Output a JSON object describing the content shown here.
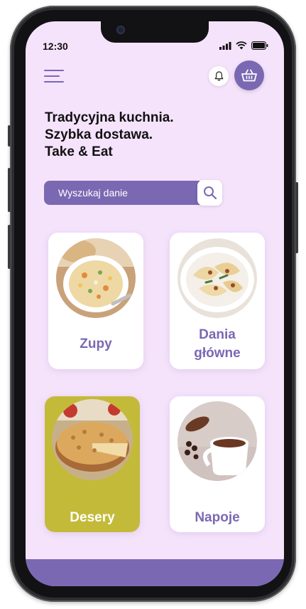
{
  "status_bar": {
    "time": "12:30"
  },
  "header": {
    "menu_icon": "hamburger-icon",
    "bell_icon": "bell-icon",
    "cart_icon": "basket-icon"
  },
  "headline": {
    "line1": "Tradycyjna kuchnia.",
    "line2": "Szybka dostawa.",
    "line3": "Take & Eat"
  },
  "search": {
    "placeholder": "Wyszukaj danie",
    "icon": "search-icon"
  },
  "categories": [
    {
      "label": "Zupy"
    },
    {
      "label_line1": "Dania",
      "label_line2": "główne"
    },
    {
      "label": "Desery"
    },
    {
      "label": "Napoje"
    }
  ],
  "colors": {
    "accent": "#7b68b3",
    "background": "#f5e3fb",
    "dessert_card": "#c4ba3a"
  }
}
